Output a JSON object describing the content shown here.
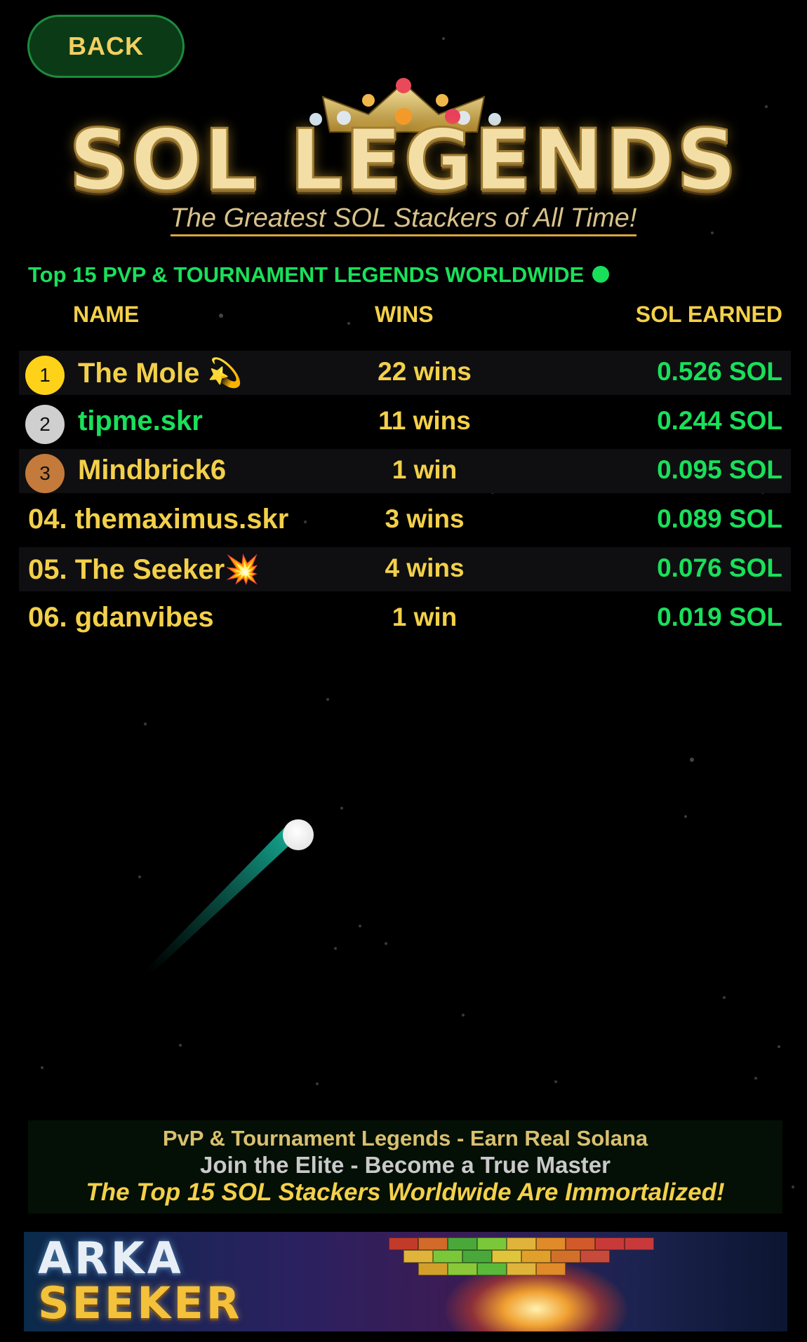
{
  "back_button": {
    "label": "BACK"
  },
  "logo": {
    "title": "SOL LEGENDS",
    "subtitle": "The Greatest SOL Stackers of All Time!"
  },
  "leaderboard": {
    "heading": "Top 15 PVP & TOURNAMENT LEGENDS WORLDWIDE",
    "columns": {
      "name": "NAME",
      "wins": "WINS",
      "sol": "SOL EARNED"
    },
    "rows": [
      {
        "rank": "1",
        "name": "The Mole 💫",
        "wins": "22 wins",
        "sol": "0.526 SOL",
        "name_color": "#f3d04a"
      },
      {
        "rank": "2",
        "name": "tipme.skr",
        "wins": "11 wins",
        "sol": "0.244 SOL",
        "name_color": "#19e05a"
      },
      {
        "rank": "3",
        "name": "Mindbrick6",
        "wins": "1 win",
        "sol": "0.095 SOL",
        "name_color": "#f3d04a"
      },
      {
        "rank": "04.",
        "name": "themaximus.skr",
        "wins": "3 wins",
        "sol": "0.089 SOL",
        "name_color": "#f3d04a"
      },
      {
        "rank": "05.",
        "name": "The Seeker💥",
        "wins": "4 wins",
        "sol": "0.076 SOL",
        "name_color": "#f3d04a"
      },
      {
        "rank": "06.",
        "name": "gdanvibes",
        "wins": "1 win",
        "sol": "0.019 SOL",
        "name_color": "#f3d04a"
      }
    ]
  },
  "promo": {
    "line1": "PvP & Tournament Legends - Earn Real Solana",
    "line2": "Join the Elite - Become a True Master",
    "line3": "The Top 15 SOL Stackers Worldwide Are Immortalized!"
  },
  "banner": {
    "line1": "ARKA",
    "line2": "SEEKER"
  },
  "colors": {
    "accent_green": "#19e05a",
    "accent_gold": "#f3d04a",
    "background": "#000000"
  }
}
